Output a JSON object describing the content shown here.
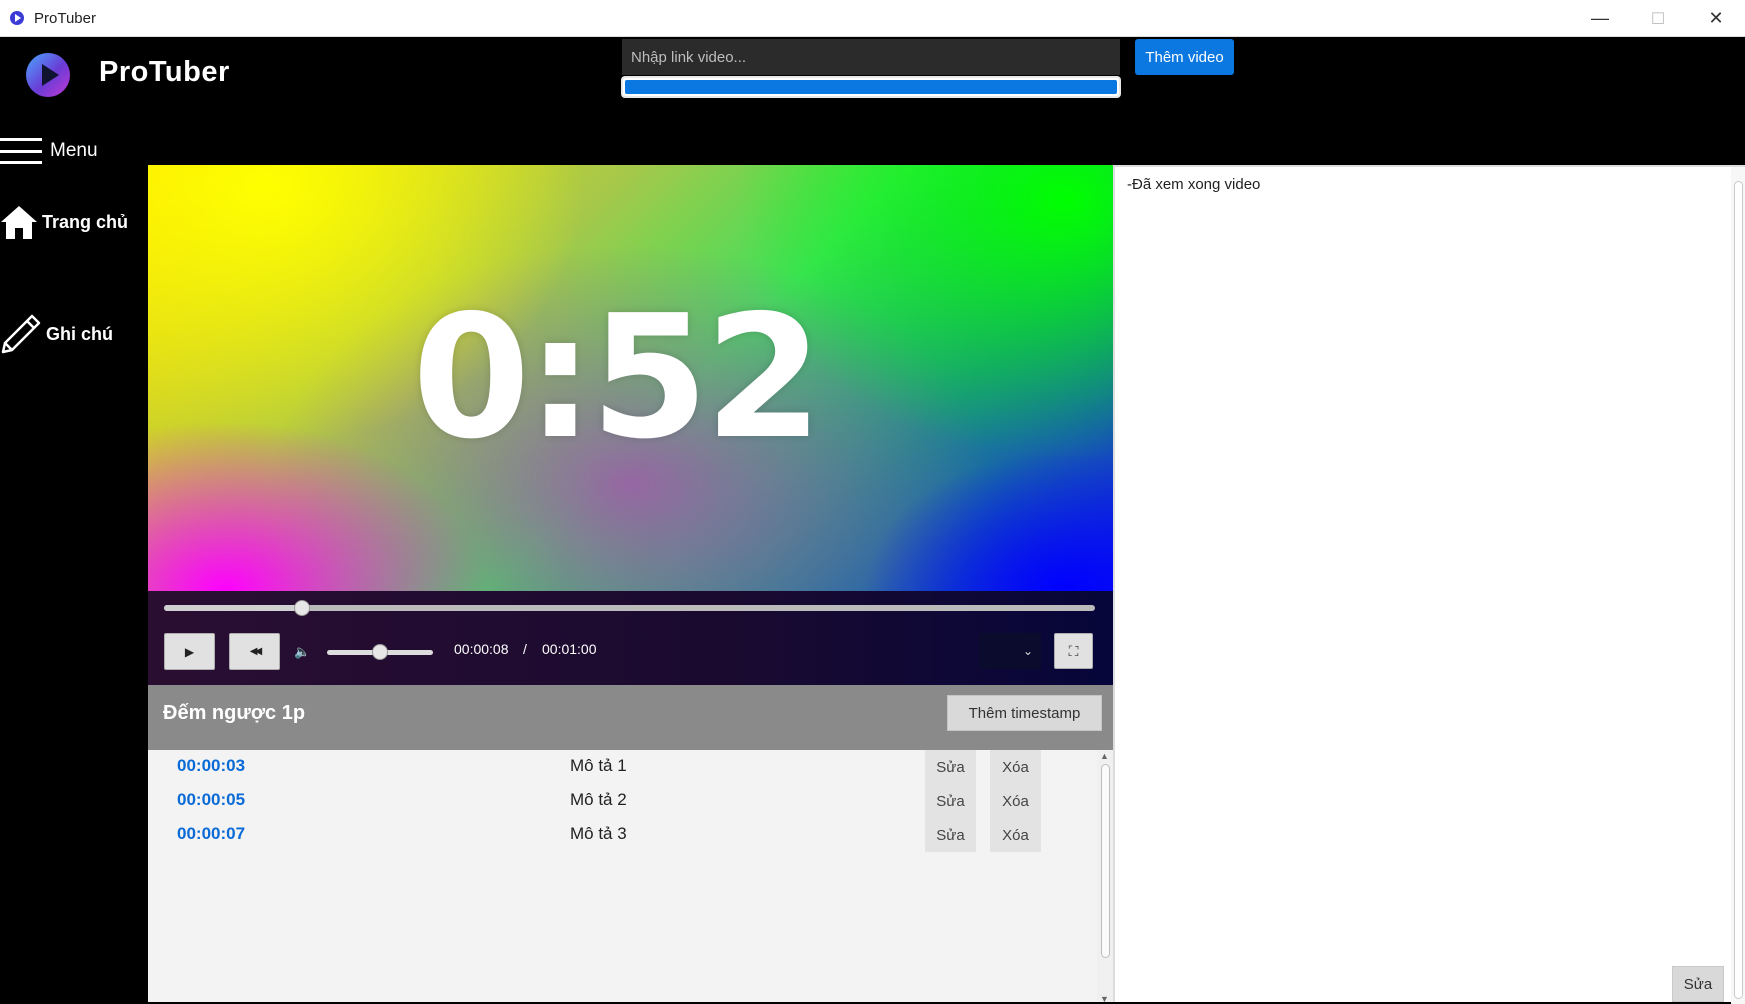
{
  "window": {
    "title": "ProTuber",
    "minimize_icon": "—",
    "maximize_icon": "☐",
    "close_icon": "✕"
  },
  "header": {
    "brand": "ProTuber",
    "url_input": {
      "placeholder": "Nhập link video...",
      "value": ""
    },
    "load_progress_percent": 100,
    "add_video_label": "Thêm video"
  },
  "sidebar": {
    "menu_label": "Menu",
    "items": [
      {
        "label": "Trang chủ",
        "icon": "home-icon"
      },
      {
        "label": "Ghi chú",
        "icon": "pencil-icon"
      }
    ]
  },
  "player": {
    "display_text": "0:52",
    "current_time": "00:00:08",
    "time_separator": "/",
    "duration": "00:01:00",
    "seek_fraction": 0.148,
    "volume_fraction": 0.5,
    "play_icon": "▶",
    "rewind_icon": "◀◀",
    "volume_icon": "🔈",
    "speed_dropdown_icon": "⌄",
    "fullscreen_icon": "⛶"
  },
  "video_info": {
    "title": "Đếm ngược 1p",
    "add_timestamp_label": "Thêm timestamp"
  },
  "timestamps": [
    {
      "time": "00:00:03",
      "description": "Mô tả 1",
      "edit_label": "Sửa",
      "delete_label": "Xóa"
    },
    {
      "time": "00:00:05",
      "description": "Mô tả 2",
      "edit_label": "Sửa",
      "delete_label": "Xóa"
    },
    {
      "time": "00:00:07",
      "description": "Mô tả 3",
      "edit_label": "Sửa",
      "delete_label": "Xóa"
    }
  ],
  "notes": {
    "text": "-Đã xem xong video",
    "edit_label": "Sửa"
  },
  "colors": {
    "accent": "#0a78e0",
    "link_time": "#0a6ad6",
    "title_bar": "#8a8a8a"
  }
}
